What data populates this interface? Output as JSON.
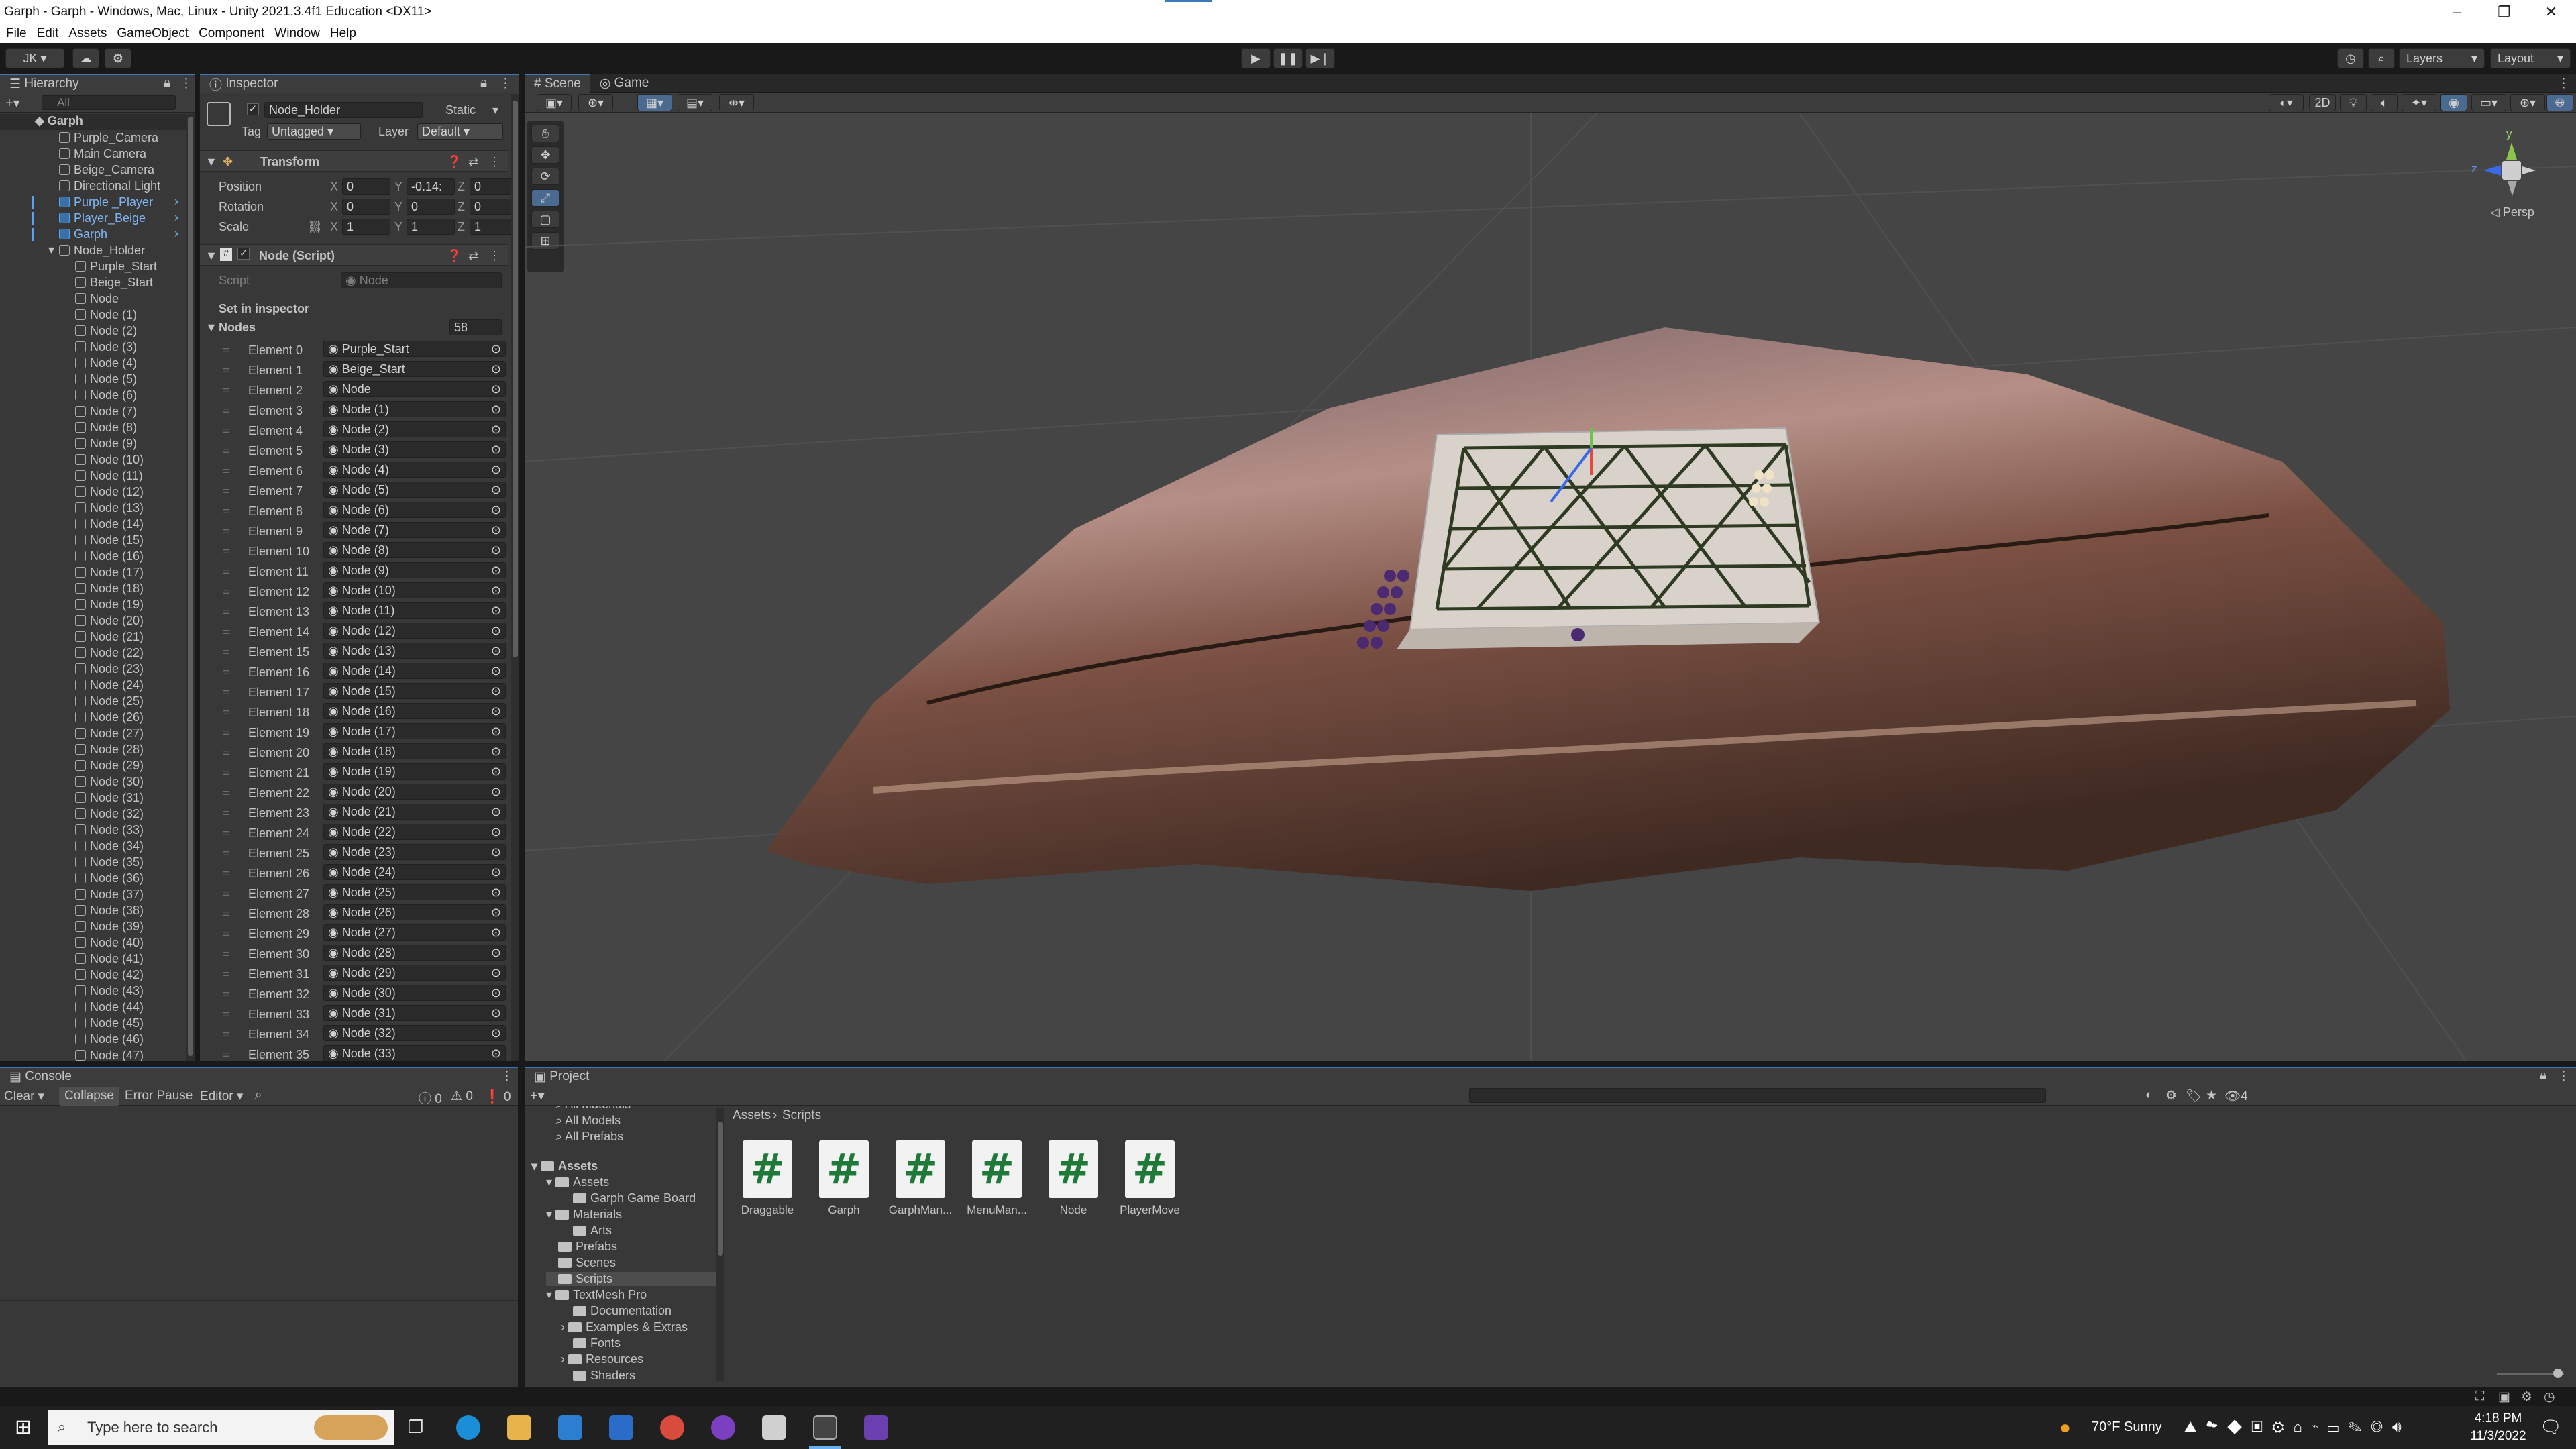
{
  "window": {
    "title": "Garph - Garph - Windows, Mac, Linux - Unity 2021.3.4f1 Education <DX11>",
    "controls": [
      "–",
      "❐",
      "✕"
    ]
  },
  "menu": [
    "File",
    "Edit",
    "Assets",
    "GameObject",
    "Component",
    "Window",
    "Help"
  ],
  "toolbar": {
    "account": "JK ▾",
    "layers": "Layers",
    "layout": "Layout"
  },
  "hierarchy": {
    "tab": "Hierarchy",
    "search_placeholder": "All",
    "scene": "Garph",
    "items": [
      {
        "label": "Purple_Camera",
        "depth": 1,
        "prefab": false
      },
      {
        "label": "Main Camera",
        "depth": 1,
        "prefab": false
      },
      {
        "label": "Beige_Camera",
        "depth": 1,
        "prefab": false
      },
      {
        "label": "Directional Light",
        "depth": 1,
        "prefab": false
      },
      {
        "label": "Purple _Player",
        "depth": 1,
        "prefab": true
      },
      {
        "label": "Player_Beige",
        "depth": 1,
        "prefab": true
      },
      {
        "label": "Garph",
        "depth": 1,
        "prefab": true
      },
      {
        "label": "Node_Holder",
        "depth": 1,
        "prefab": false
      },
      {
        "label": "Purple_Start",
        "depth": 2,
        "prefab": false
      },
      {
        "label": "Beige_Start",
        "depth": 2,
        "prefab": false
      },
      {
        "label": "Node",
        "depth": 2,
        "prefab": false
      },
      {
        "label": "Node (1)",
        "depth": 2,
        "prefab": false
      },
      {
        "label": "Node (2)",
        "depth": 2,
        "prefab": false
      },
      {
        "label": "Node (3)",
        "depth": 2,
        "prefab": false
      },
      {
        "label": "Node (4)",
        "depth": 2,
        "prefab": false
      },
      {
        "label": "Node (5)",
        "depth": 2,
        "prefab": false
      },
      {
        "label": "Node (6)",
        "depth": 2,
        "prefab": false
      },
      {
        "label": "Node (7)",
        "depth": 2,
        "prefab": false
      },
      {
        "label": "Node (8)",
        "depth": 2,
        "prefab": false
      },
      {
        "label": "Node (9)",
        "depth": 2,
        "prefab": false
      },
      {
        "label": "Node (10)",
        "depth": 2,
        "prefab": false
      },
      {
        "label": "Node (11)",
        "depth": 2,
        "prefab": false
      },
      {
        "label": "Node (12)",
        "depth": 2,
        "prefab": false
      },
      {
        "label": "Node (13)",
        "depth": 2,
        "prefab": false
      },
      {
        "label": "Node (14)",
        "depth": 2,
        "prefab": false
      },
      {
        "label": "Node (15)",
        "depth": 2,
        "prefab": false
      },
      {
        "label": "Node (16)",
        "depth": 2,
        "prefab": false
      },
      {
        "label": "Node (17)",
        "depth": 2,
        "prefab": false
      },
      {
        "label": "Node (18)",
        "depth": 2,
        "prefab": false
      },
      {
        "label": "Node (19)",
        "depth": 2,
        "prefab": false
      },
      {
        "label": "Node (20)",
        "depth": 2,
        "prefab": false
      },
      {
        "label": "Node (21)",
        "depth": 2,
        "prefab": false
      },
      {
        "label": "Node (22)",
        "depth": 2,
        "prefab": false
      },
      {
        "label": "Node (23)",
        "depth": 2,
        "prefab": false
      },
      {
        "label": "Node (24)",
        "depth": 2,
        "prefab": false
      },
      {
        "label": "Node (25)",
        "depth": 2,
        "prefab": false
      },
      {
        "label": "Node (26)",
        "depth": 2,
        "prefab": false
      },
      {
        "label": "Node (27)",
        "depth": 2,
        "prefab": false
      },
      {
        "label": "Node (28)",
        "depth": 2,
        "prefab": false
      },
      {
        "label": "Node (29)",
        "depth": 2,
        "prefab": false
      },
      {
        "label": "Node (30)",
        "depth": 2,
        "prefab": false
      },
      {
        "label": "Node (31)",
        "depth": 2,
        "prefab": false
      },
      {
        "label": "Node (32)",
        "depth": 2,
        "prefab": false
      },
      {
        "label": "Node (33)",
        "depth": 2,
        "prefab": false
      },
      {
        "label": "Node (34)",
        "depth": 2,
        "prefab": false
      },
      {
        "label": "Node (35)",
        "depth": 2,
        "prefab": false
      },
      {
        "label": "Node (36)",
        "depth": 2,
        "prefab": false
      },
      {
        "label": "Node (37)",
        "depth": 2,
        "prefab": false
      },
      {
        "label": "Node (38)",
        "depth": 2,
        "prefab": false
      },
      {
        "label": "Node (39)",
        "depth": 2,
        "prefab": false
      },
      {
        "label": "Node (40)",
        "depth": 2,
        "prefab": false
      },
      {
        "label": "Node (41)",
        "depth": 2,
        "prefab": false
      },
      {
        "label": "Node (42)",
        "depth": 2,
        "prefab": false
      },
      {
        "label": "Node (43)",
        "depth": 2,
        "prefab": false
      },
      {
        "label": "Node (44)",
        "depth": 2,
        "prefab": false
      },
      {
        "label": "Node (45)",
        "depth": 2,
        "prefab": false
      },
      {
        "label": "Node (46)",
        "depth": 2,
        "prefab": false
      },
      {
        "label": "Node (47)",
        "depth": 2,
        "prefab": false
      }
    ]
  },
  "inspector": {
    "tab": "Inspector",
    "object_name": "Node_Holder",
    "static_label": "Static",
    "tag_label": "Tag",
    "tag_value": "Untagged",
    "layer_label": "Layer",
    "layer_value": "Default",
    "transform": {
      "title": "Transform",
      "position_label": "Position",
      "position": [
        "0",
        "-0.14:",
        "0"
      ],
      "rotation_label": "Rotation",
      "rotation": [
        "0",
        "0",
        "0"
      ],
      "scale_label": "Scale",
      "scale": [
        "1",
        "1",
        "1"
      ],
      "axes": [
        "X",
        "Y",
        "Z"
      ]
    },
    "node_script": {
      "title": "Node (Script)",
      "script_label": "Script",
      "script_value": "Node",
      "set_in_inspector": "Set in inspector",
      "nodes_label": "Nodes",
      "nodes_count": "58",
      "elements": [
        {
          "label": "Element 0",
          "value": "Purple_Start"
        },
        {
          "label": "Element 1",
          "value": "Beige_Start"
        },
        {
          "label": "Element 2",
          "value": "Node"
        },
        {
          "label": "Element 3",
          "value": "Node (1)"
        },
        {
          "label": "Element 4",
          "value": "Node (2)"
        },
        {
          "label": "Element 5",
          "value": "Node (3)"
        },
        {
          "label": "Element 6",
          "value": "Node (4)"
        },
        {
          "label": "Element 7",
          "value": "Node (5)"
        },
        {
          "label": "Element 8",
          "value": "Node (6)"
        },
        {
          "label": "Element 9",
          "value": "Node (7)"
        },
        {
          "label": "Element 10",
          "value": "Node (8)"
        },
        {
          "label": "Element 11",
          "value": "Node (9)"
        },
        {
          "label": "Element 12",
          "value": "Node (10)"
        },
        {
          "label": "Element 13",
          "value": "Node (11)"
        },
        {
          "label": "Element 14",
          "value": "Node (12)"
        },
        {
          "label": "Element 15",
          "value": "Node (13)"
        },
        {
          "label": "Element 16",
          "value": "Node (14)"
        },
        {
          "label": "Element 17",
          "value": "Node (15)"
        },
        {
          "label": "Element 18",
          "value": "Node (16)"
        },
        {
          "label": "Element 19",
          "value": "Node (17)"
        },
        {
          "label": "Element 20",
          "value": "Node (18)"
        },
        {
          "label": "Element 21",
          "value": "Node (19)"
        },
        {
          "label": "Element 22",
          "value": "Node (20)"
        },
        {
          "label": "Element 23",
          "value": "Node (21)"
        },
        {
          "label": "Element 24",
          "value": "Node (22)"
        },
        {
          "label": "Element 25",
          "value": "Node (23)"
        },
        {
          "label": "Element 26",
          "value": "Node (24)"
        },
        {
          "label": "Element 27",
          "value": "Node (25)"
        },
        {
          "label": "Element 28",
          "value": "Node (26)"
        },
        {
          "label": "Element 29",
          "value": "Node (27)"
        },
        {
          "label": "Element 30",
          "value": "Node (28)"
        },
        {
          "label": "Element 31",
          "value": "Node (29)"
        },
        {
          "label": "Element 32",
          "value": "Node (30)"
        },
        {
          "label": "Element 33",
          "value": "Node (31)"
        },
        {
          "label": "Element 34",
          "value": "Node (32)"
        },
        {
          "label": "Element 35",
          "value": "Node (33)"
        }
      ]
    }
  },
  "scene": {
    "tabs": [
      "Scene",
      "Game"
    ],
    "view_2d": "2D",
    "persp_label": "◁ Persp",
    "gizmo_axes": [
      "y",
      "z",
      "x"
    ]
  },
  "console": {
    "tab": "Console",
    "buttons": [
      "Clear ▾",
      "Collapse",
      "Error Pause",
      "Editor ▾"
    ],
    "counts": [
      "0",
      "0",
      "0"
    ]
  },
  "project": {
    "tab": "Project",
    "favorites": [
      "All Materials",
      "All Models",
      "All Prefabs"
    ],
    "tree": [
      {
        "label": "Assets",
        "depth": 0,
        "bold": true
      },
      {
        "label": "Assets",
        "depth": 1
      },
      {
        "label": "Garph Game Board",
        "depth": 2
      },
      {
        "label": "Materials",
        "depth": 1
      },
      {
        "label": "Arts",
        "depth": 2
      },
      {
        "label": "Prefabs",
        "depth": 1
      },
      {
        "label": "Scenes",
        "depth": 1
      },
      {
        "label": "Scripts",
        "depth": 1,
        "selected": true
      },
      {
        "label": "TextMesh Pro",
        "depth": 1
      },
      {
        "label": "Documentation",
        "depth": 2
      },
      {
        "label": "Examples & Extras",
        "depth": 2
      },
      {
        "label": "Fonts",
        "depth": 2
      },
      {
        "label": "Resources",
        "depth": 2
      },
      {
        "label": "Shaders",
        "depth": 2
      }
    ],
    "breadcrumb": [
      "Assets",
      "Scripts"
    ],
    "assets": [
      "Draggable",
      "Garph",
      "GarphMan...",
      "MenuMan...",
      "Node",
      "PlayerMove"
    ],
    "asset_glyph": "#",
    "slider_count": "4"
  },
  "taskbar": {
    "search_placeholder": "Type here to search",
    "weather": "70°F  Sunny",
    "time": "4:18 PM",
    "date": "11/3/2022"
  },
  "colors": {
    "accent": "#3a79bb",
    "prefab_blue": "#7fb6f0",
    "script_green": "#1f7a3a"
  }
}
